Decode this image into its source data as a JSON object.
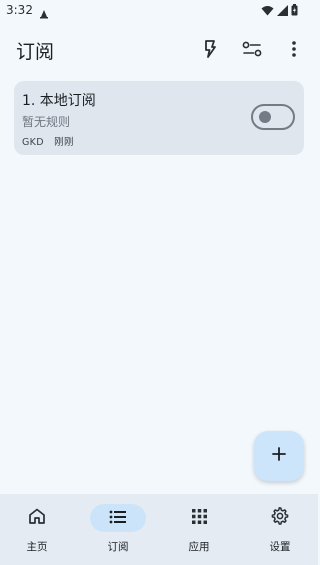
{
  "status": {
    "time": "3:32"
  },
  "header": {
    "title": "订阅"
  },
  "subscriptions": [
    {
      "title": "1. 本地订阅",
      "subtitle": "暂无规则",
      "tags": [
        "GKD",
        "刚刚"
      ],
      "enabled": false
    }
  ],
  "nav": {
    "items": [
      {
        "label": "主页",
        "icon": "home-icon",
        "active": false
      },
      {
        "label": "订阅",
        "icon": "list-icon",
        "active": true
      },
      {
        "label": "应用",
        "icon": "apps-grid-icon",
        "active": false
      },
      {
        "label": "设置",
        "icon": "gear-icon",
        "active": false
      }
    ]
  },
  "colors": {
    "background": "#f3f8fd",
    "card": "#dfe6ee",
    "fab": "#cde5fa",
    "nav_active": "#cce4f9"
  }
}
